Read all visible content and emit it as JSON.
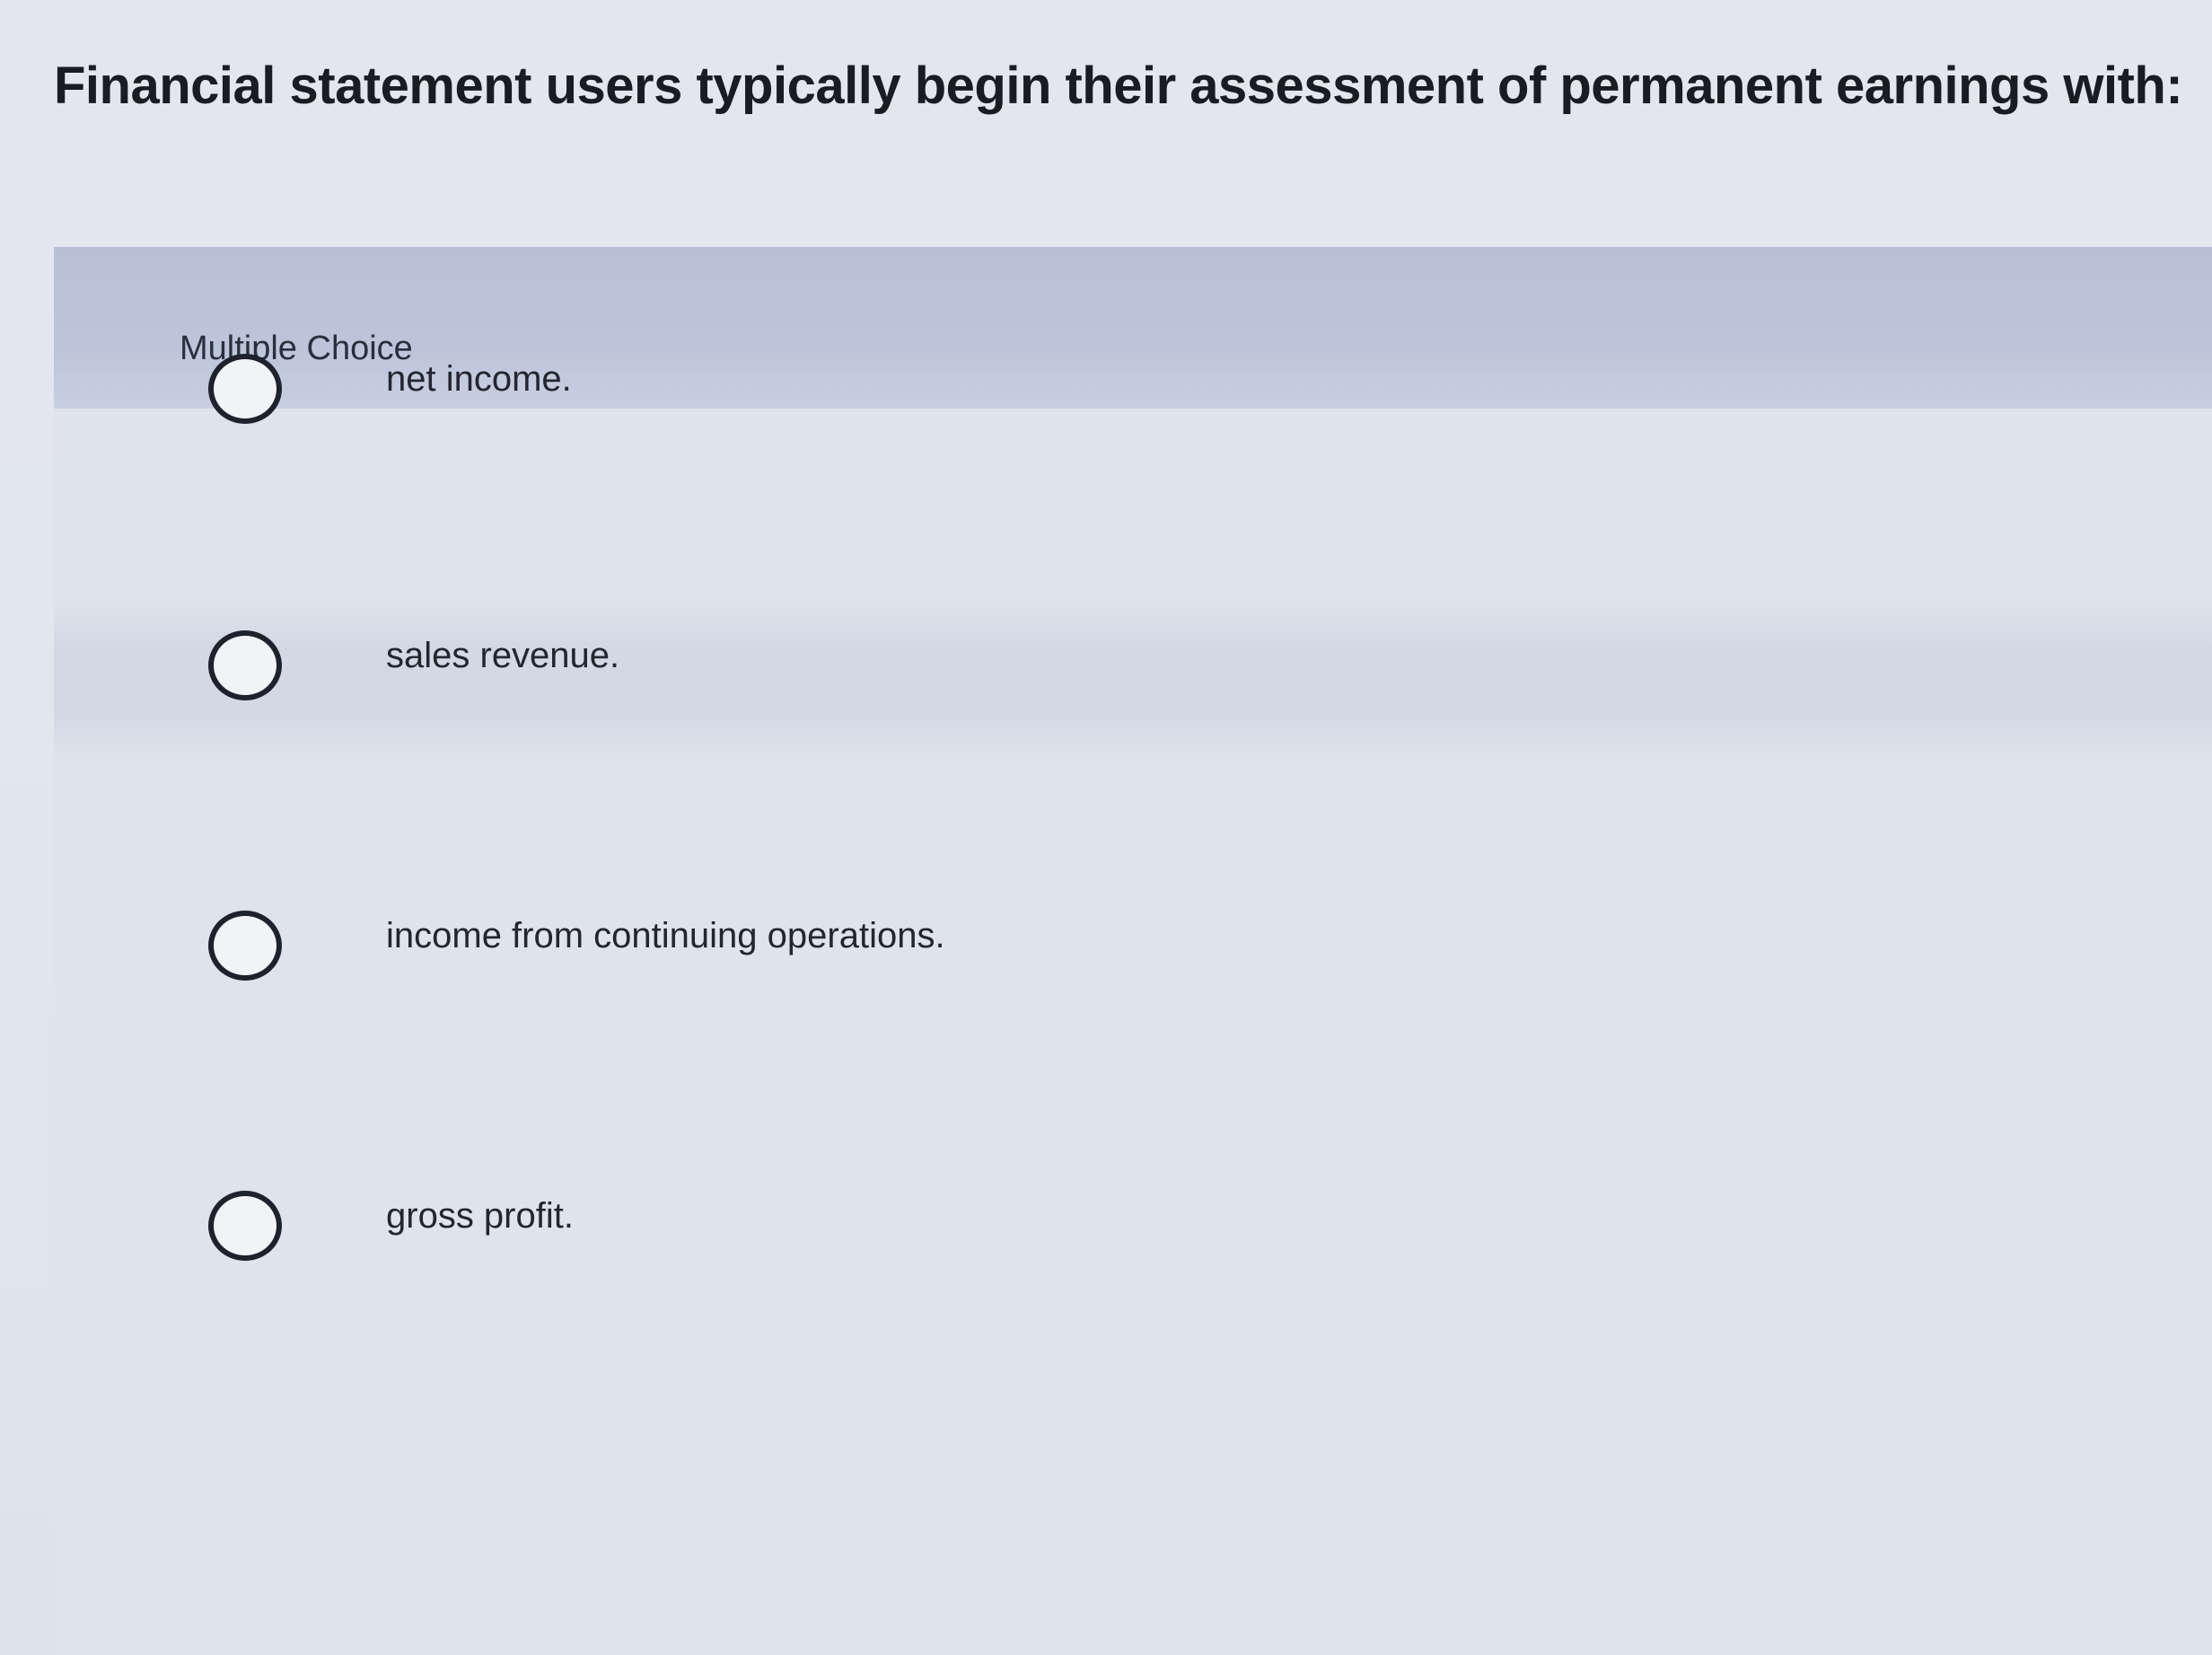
{
  "question": {
    "text": "Financial statement users typically begin their assessment of permanent earnings with:"
  },
  "panel": {
    "header_label": "Multiple Choice"
  },
  "options": [
    {
      "label": "net income."
    },
    {
      "label": "sales revenue."
    },
    {
      "label": "income from continuing operations."
    },
    {
      "label": "gross profit."
    }
  ]
}
